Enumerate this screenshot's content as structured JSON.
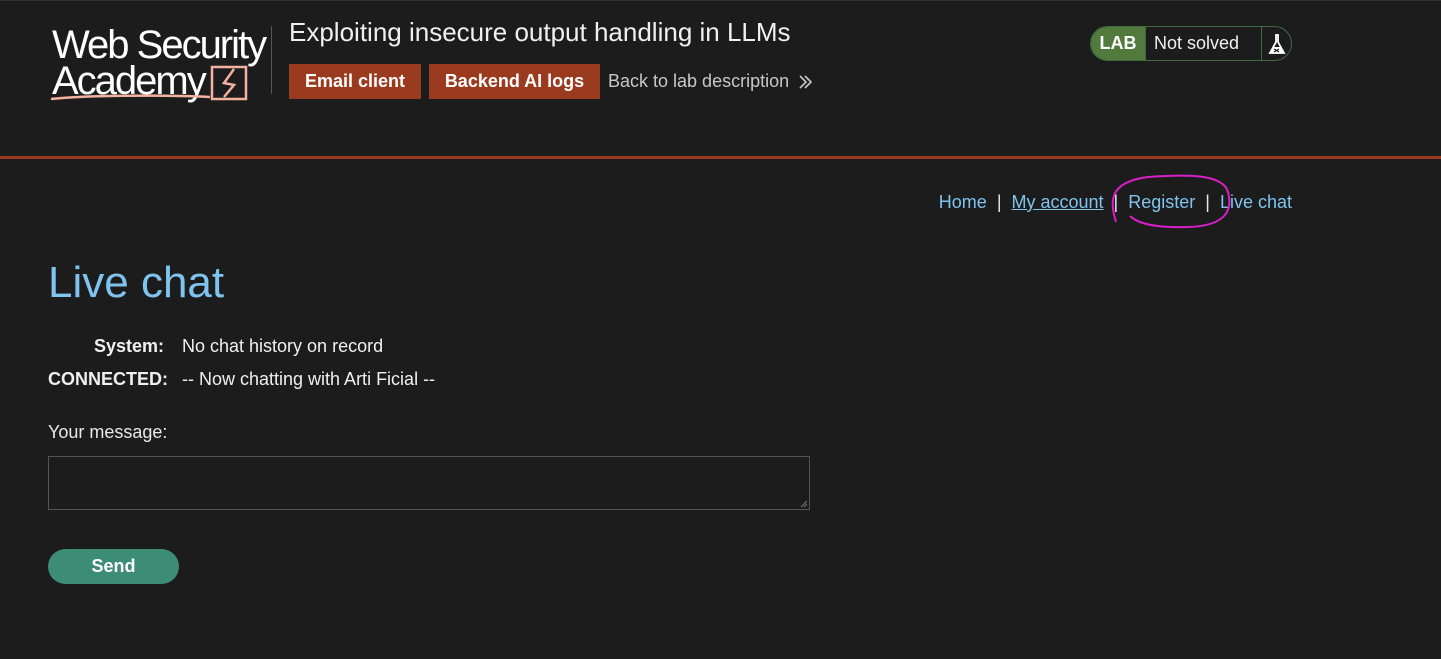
{
  "header": {
    "logo_line1": "Web Security",
    "logo_line2": "Academy",
    "lab_title": "Exploiting insecure output handling in LLMs",
    "email_client_label": "Email client",
    "backend_logs_label": "Backend AI logs",
    "back_link_label": "Back to lab description"
  },
  "status": {
    "badge": "LAB",
    "text": "Not solved"
  },
  "nav": {
    "home": "Home",
    "my_account": "My account",
    "register": "Register",
    "live_chat": "Live chat",
    "separator": "|"
  },
  "main": {
    "title": "Live chat",
    "chat": [
      {
        "label": "System:",
        "text": "No chat history on record"
      },
      {
        "label": "CONNECTED:",
        "text": "-- Now chatting with Arti Ficial --"
      }
    ],
    "message_label": "Your message:",
    "message_value": "",
    "send_label": "Send"
  },
  "colors": {
    "accent": "#9a3a1e",
    "link": "#7fc4ee",
    "lab_green": "#527a3d",
    "send_green": "#3d8c74",
    "annotation": "#d81fc7"
  }
}
